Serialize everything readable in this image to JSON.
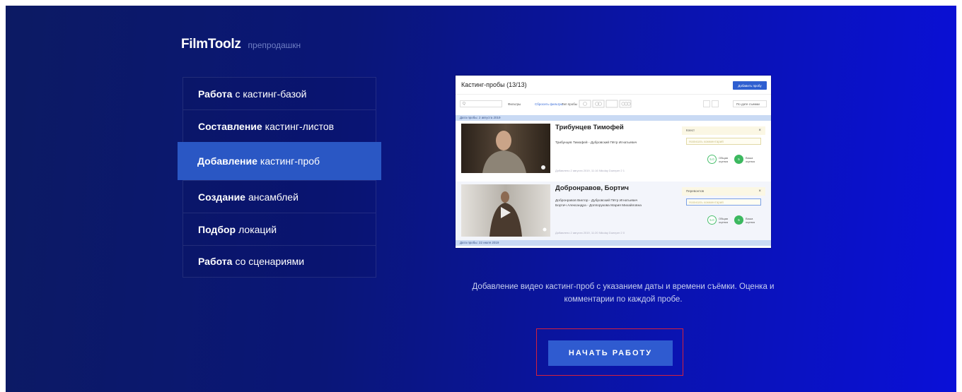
{
  "brand": {
    "logo": "FilmToolz",
    "tagline": "препродашкн"
  },
  "menu": [
    {
      "bold": "Работа",
      "rest": "с кастинг-базой",
      "active": false
    },
    {
      "bold": "Составление",
      "rest": "кастинг-листов",
      "active": false
    },
    {
      "bold": "Добавление",
      "rest": "кастинг-проб",
      "active": true
    },
    {
      "bold": "Создание",
      "rest": "ансамблей",
      "active": false
    },
    {
      "bold": "Подбор",
      "rest": "локаций",
      "active": false
    },
    {
      "bold": "Работа",
      "rest": "со сценариями",
      "active": false
    }
  ],
  "preview": {
    "title": "Кастинг-пробы (13/13)",
    "add_button": "Добавить пробу",
    "search_placeholder": "Q",
    "filters_label": "Фильтры",
    "reset_filters": "Сбросить фильтры",
    "type_label": "Тип пробы",
    "sort_label": "По дате съемки",
    "date_group_1": "Дата пробы: 2 августа 2019",
    "date_group_2": "Дата пробы: 22 июля 2019",
    "rows": [
      {
        "name": "Трибунцев Тимофей",
        "desc_1": "Трибунцев Тимофей - Дубровский Пётр Игнатьевич",
        "desc_2": "",
        "meta": "Добавлено 2 августа 2019, 11:16 Nikolay Dueeper   2 1",
        "tag": "Клест",
        "comment_placeholder": "Написать комментарий",
        "overall_score": "5.0",
        "overall_label_1": "Общая",
        "overall_label_2": "оценка",
        "your_score": "5",
        "your_label_1": "Ваша",
        "your_label_2": "оценка"
      },
      {
        "name": "Добронравов, Бортич",
        "desc_1": "Добронравов Виктор - Дубровский Пётр Игнатьевич",
        "desc_2": "Бортич Александра - Доппорукова Мария Михайловна",
        "meta": "Добавлено 2 августа 2019, 11:20 Nikolay Dueeper   2 0",
        "tag": "Перевонтов",
        "comment_placeholder": "Написать комментарий",
        "overall_score": "5.0",
        "overall_label_1": "Общая",
        "overall_label_2": "оценка",
        "your_score": "5",
        "your_label_1": "Ваша",
        "your_label_2": "оценка"
      }
    ]
  },
  "caption": "Добавление видео кастинг-проб с указанием даты и времени съёмки. Оценка и комментарии по каждой пробе.",
  "start_button": "НАЧАТЬ РАБОТУ",
  "colors": {
    "accent": "#2f5bd0",
    "active_menu": "#2a57c4",
    "highlight_outline": "#d4213d"
  }
}
